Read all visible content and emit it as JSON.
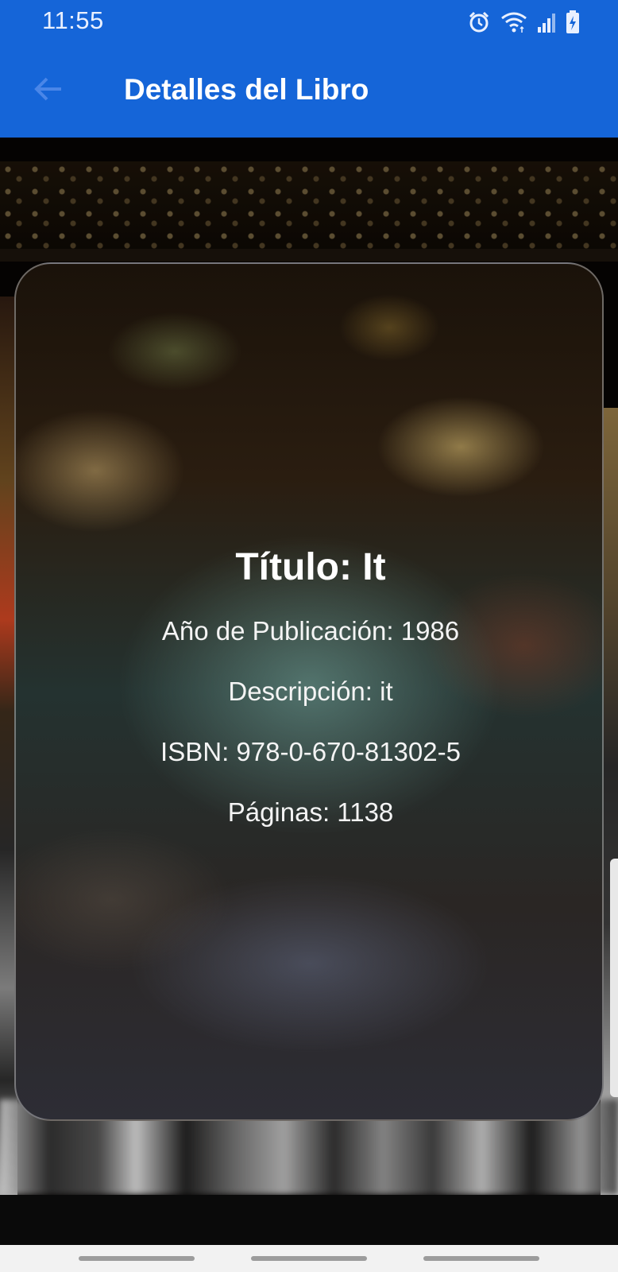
{
  "status_bar": {
    "time": "11:55",
    "icons": [
      "alarm-icon",
      "wifi-icon",
      "signal-icon",
      "battery-charging-icon"
    ]
  },
  "app_bar": {
    "title": "Detalles del Libro",
    "back_icon": "arrow-left-icon",
    "color": "#1565d8"
  },
  "book": {
    "title": "Título: It",
    "year": "Año de Publicación: 1986",
    "description": "Descripción: it",
    "isbn": "ISBN: 978-0-670-81302-5",
    "pages": "Páginas: 1138"
  },
  "nav_bar": {
    "buttons": [
      "recents",
      "home",
      "back"
    ]
  }
}
